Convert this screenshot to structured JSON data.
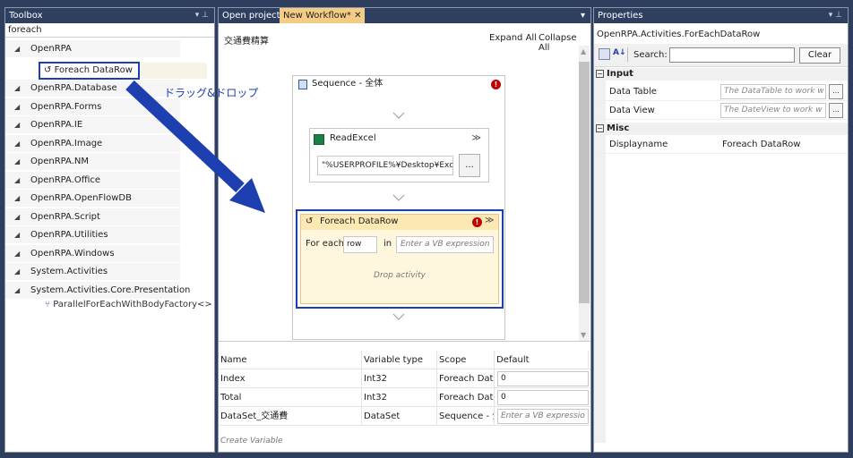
{
  "toolbox": {
    "title": "Toolbox",
    "search_value": "foreach",
    "items": [
      {
        "label": "OpenRPA"
      },
      {
        "label": "OpenRPA.Database"
      },
      {
        "label": "OpenRPA.Forms"
      },
      {
        "label": "OpenRPA.IE"
      },
      {
        "label": "OpenRPA.Image"
      },
      {
        "label": "OpenRPA.NM"
      },
      {
        "label": "OpenRPA.Office"
      },
      {
        "label": "OpenRPA.OpenFlowDB"
      },
      {
        "label": "OpenRPA.Script"
      },
      {
        "label": "OpenRPA.Utilities"
      },
      {
        "label": "OpenRPA.Windows"
      },
      {
        "label": "System.Activities"
      },
      {
        "label": "System.Activities.Core.Presentation"
      }
    ],
    "selected_item": "Foreach DataRow",
    "sub_item": "ParallelForEachWithBodyFactory<>"
  },
  "designer": {
    "tabs": [
      {
        "label": "Open project"
      },
      {
        "label": "New Workflow* ✕"
      }
    ],
    "workflow_title": "交通費精算",
    "expand_all": "Expand All",
    "collapse_all": "Collapse All",
    "sequence_label": "Sequence - 全体",
    "read_excel": {
      "label": "ReadExcel",
      "path": "\"%USERPROFILE%¥Desktop¥Exc",
      "browse": "..."
    },
    "foreach": {
      "label": "Foreach DataRow",
      "for_each": "For each",
      "var": "row",
      "in": "in",
      "expr_placeholder": "Enter a VB expression",
      "drop": "Drop activity"
    }
  },
  "variables": {
    "headers": {
      "name": "Name",
      "type": "Variable type",
      "scope": "Scope",
      "default": "Default"
    },
    "rows": [
      {
        "name": "Index",
        "type": "Int32",
        "scope": "Foreach DataI",
        "default": "0"
      },
      {
        "name": "Total",
        "type": "Int32",
        "scope": "Foreach DataI",
        "default": "0"
      },
      {
        "name": "DataSet_交通費",
        "type": "DataSet",
        "scope": "Sequence - 全",
        "default": "Enter a VB expressio"
      }
    ],
    "create": "Create Variable"
  },
  "properties": {
    "title": "Properties",
    "type_name": "OpenRPA.Activities.ForEachDataRow",
    "search_label": "Search:",
    "clear": "Clear",
    "categories": [
      {
        "name": "Input"
      },
      {
        "name": "Misc"
      }
    ],
    "rows": [
      {
        "name": "Data Table",
        "value": "The DataTable to work w"
      },
      {
        "name": "Data View",
        "value": "The DateView to work w"
      },
      {
        "name": "Displayname",
        "value": "Foreach DataRow"
      }
    ]
  },
  "annotation": {
    "drag_drop": "ドラッグ&ドロップ"
  },
  "colors": {
    "title_bar": "#2f3f5f",
    "active_tab": "#f5cc84",
    "highlight_border": "#1e3fb0",
    "error_red": "#c00000"
  }
}
